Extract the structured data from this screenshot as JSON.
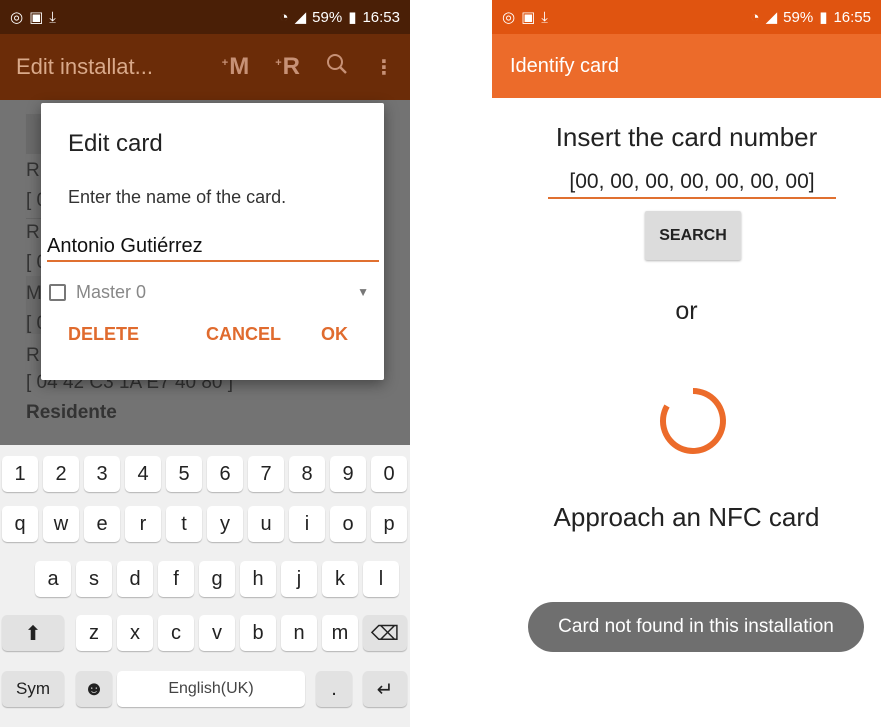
{
  "left_screen": {
    "statusbar": {
      "left_icons": [
        "whatsapp-icon",
        "gallery-icon",
        "download-icon"
      ],
      "battery": "59%",
      "time": "16:53"
    },
    "appbar": {
      "title": "Edit installat...",
      "action_m": "M",
      "action_r": "R",
      "search_icon": "search-icon",
      "menu_icon": "more-vert-icon"
    },
    "background": {
      "lines": [
        "R",
        "[ 0",
        "R",
        "[ 0",
        "M",
        "[ 0",
        "R",
        "[ 04 42 C3 1A E7 40 80 ]",
        "Residente"
      ]
    },
    "dialog": {
      "title": "Edit card",
      "message": "Enter the name of the card.",
      "name_value": "Antonio Gutiérrez",
      "master_label": "Master 0",
      "delete_label": "DELETE",
      "cancel_label": "CANCEL",
      "ok_label": "OK"
    },
    "keyboard": {
      "row_numbers": [
        "1",
        "2",
        "3",
        "4",
        "5",
        "6",
        "7",
        "8",
        "9",
        "0"
      ],
      "row_qwerty": [
        "q",
        "w",
        "e",
        "r",
        "t",
        "y",
        "u",
        "i",
        "o",
        "p"
      ],
      "row_asdf": [
        "a",
        "s",
        "d",
        "f",
        "g",
        "h",
        "j",
        "k",
        "l"
      ],
      "row_zxcv": [
        "z",
        "x",
        "c",
        "v",
        "b",
        "n",
        "m"
      ],
      "shift_icon": "shift-icon",
      "backspace_icon": "backspace-icon",
      "sym_label": "Sym",
      "emoji_icon": "emoji-icon",
      "space_label": "English(UK)",
      "period_label": ".",
      "enter_icon": "enter-icon"
    }
  },
  "right_screen": {
    "statusbar": {
      "left_icons": [
        "whatsapp-icon",
        "gallery-icon",
        "download-icon"
      ],
      "battery": "59%",
      "time": "16:55"
    },
    "appbar": {
      "title": "Identify card"
    },
    "heading": "Insert the card number",
    "card_number_value": "[00, 00, 00, 00, 00, 00, 00]",
    "search_label": "SEARCH",
    "or_label": "or",
    "nfc_label": "Approach an NFC card",
    "toast": "Card not found in this installation"
  },
  "colors": {
    "accent": "#e06b2e",
    "appbar_right": "#ec6b2a",
    "statusbar_right": "#e05410",
    "appbar_left_dimmed": "#6b2c08"
  }
}
